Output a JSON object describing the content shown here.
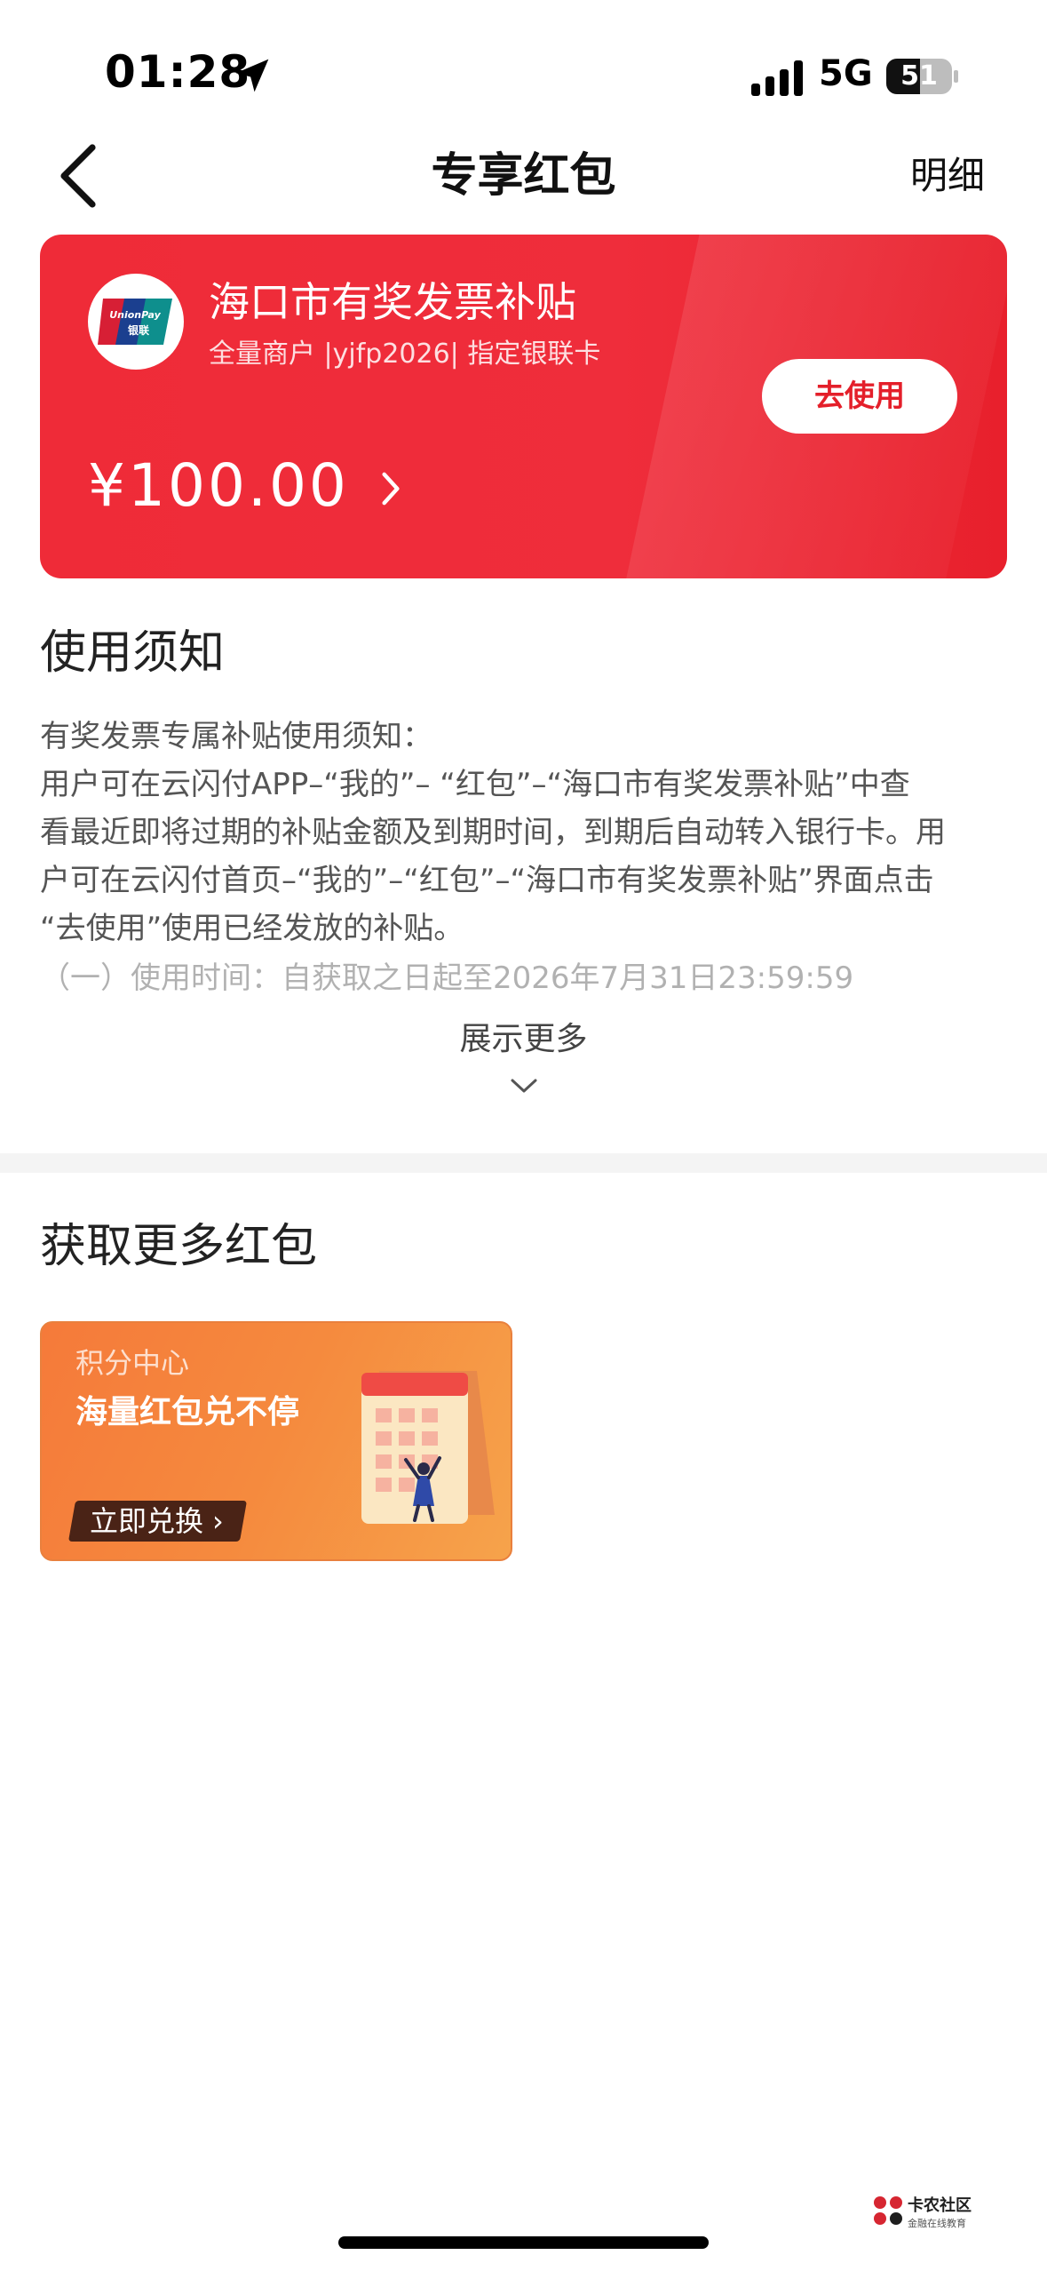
{
  "status_bar": {
    "time": "01:28",
    "network": "5G",
    "battery": "51",
    "battery_level": 0.51
  },
  "nav": {
    "title": "专享红包",
    "detail_label": "明细",
    "back_icon": "chevron-left-icon"
  },
  "red_packet": {
    "logo_icon": "unionpay-logo-icon",
    "title": "海口市有奖发票补贴",
    "subtitle": "全量商户 |yjfp2026| 指定银联卡",
    "amount": "¥100.00",
    "use_button_label": "去使用",
    "colors": {
      "card": "#ef2b38",
      "button_text": "#e41f2a"
    }
  },
  "notice": {
    "title": "使用须知",
    "line1": "有奖发票专属补贴使用须知：",
    "line2": "用户可在云闪付APP–“我的”– “红包”–“海口市有奖发票补贴”中查",
    "line3": "看最近即将过期的补贴金额及到期时间，到期后自动转入银行卡。用",
    "line4": "户可在云闪付首页–“我的”–“红包”–“海口市有奖发票补贴”界面点击",
    "line5": "“去使用”使用已经发放的补贴。",
    "line6": "（一）使用时间：自获取之日起至2026年7月31日23:59:59",
    "show_more_label": "展示更多"
  },
  "more_section": {
    "title": "获取更多红包",
    "promo": {
      "tag": "积分中心",
      "headline": "海量红包兑不停",
      "button_label": "立即兑换",
      "button_suffix": "›",
      "colors": {
        "start": "#f57a3a",
        "end": "#f6a34b"
      }
    }
  },
  "watermark": {
    "name": "卡农社区",
    "tagline": "金融在线教育"
  }
}
